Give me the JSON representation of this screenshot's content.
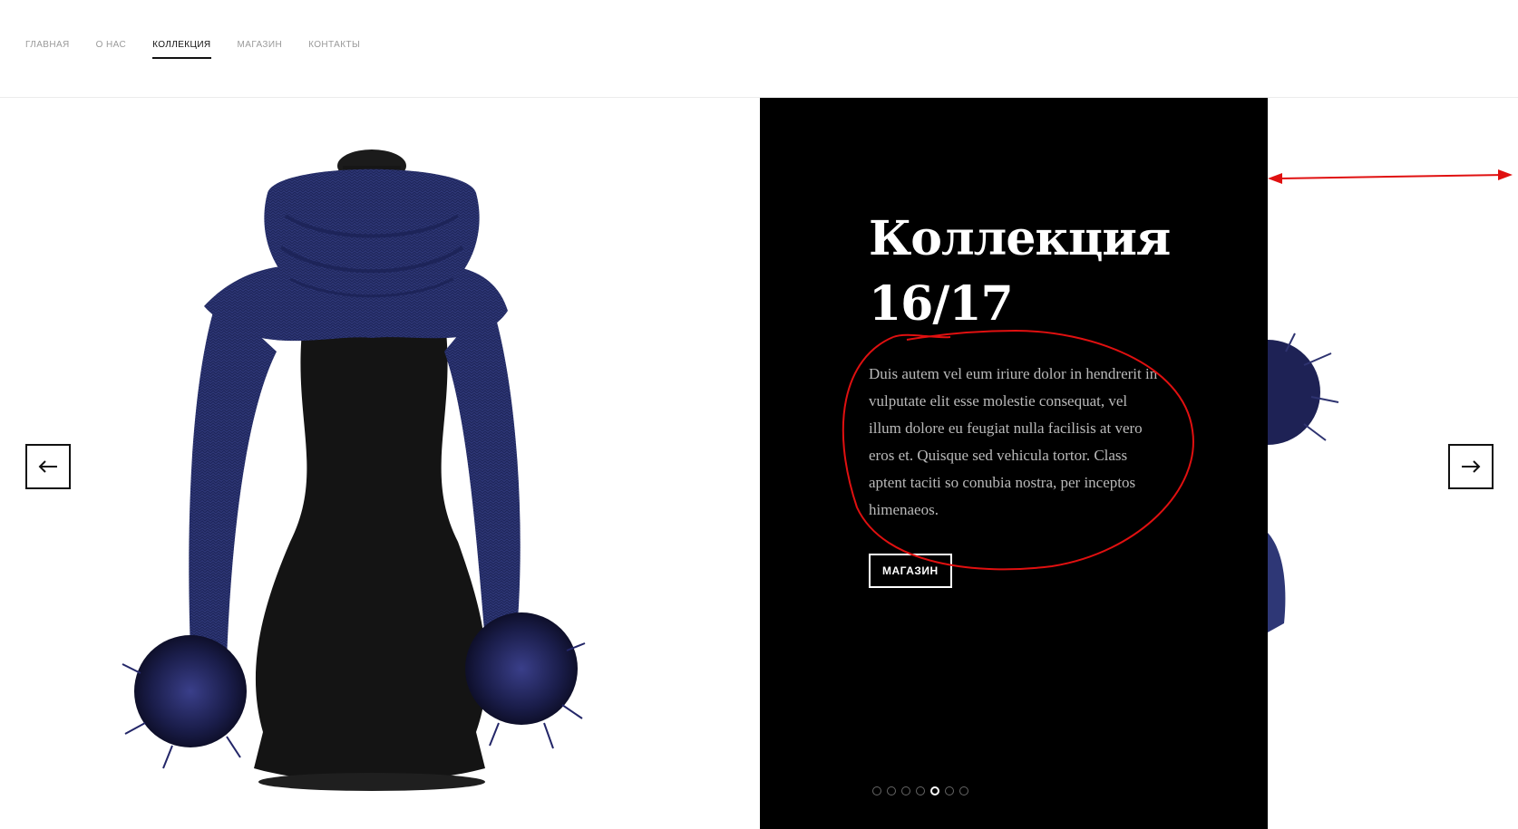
{
  "nav": {
    "items": [
      {
        "label": "ГЛАВНАЯ",
        "active": false
      },
      {
        "label": "О НАС",
        "active": false
      },
      {
        "label": "КОЛЛЕКЦИЯ",
        "active": true
      },
      {
        "label": "МАГАЗИН",
        "active": false
      },
      {
        "label": "КОНТАКТЫ",
        "active": false
      }
    ]
  },
  "slide": {
    "title_line1": "Коллекция",
    "title_line2": "16/17",
    "description": "Duis autem vel eum iriure dolor in hendrerit in vulputate elit esse molestie consequat, vel illum dolore eu feugiat nulla facilisis at vero eros et. Quisque sed vehicula tortor. Class aptent taciti so conubia nostra, per inceptos himenaeos.",
    "button_label": "МАГАЗИН"
  },
  "pagination": {
    "total": 7,
    "active_index": 4
  },
  "controls": {
    "prev_icon": "arrow-left-icon",
    "next_icon": "arrow-right-icon"
  },
  "colors": {
    "panel_bg": "#000000",
    "accent_annotation": "#e01010",
    "scarf_blue": "#2c3573",
    "nav_inactive": "#9a9a9a",
    "nav_active": "#111111"
  }
}
